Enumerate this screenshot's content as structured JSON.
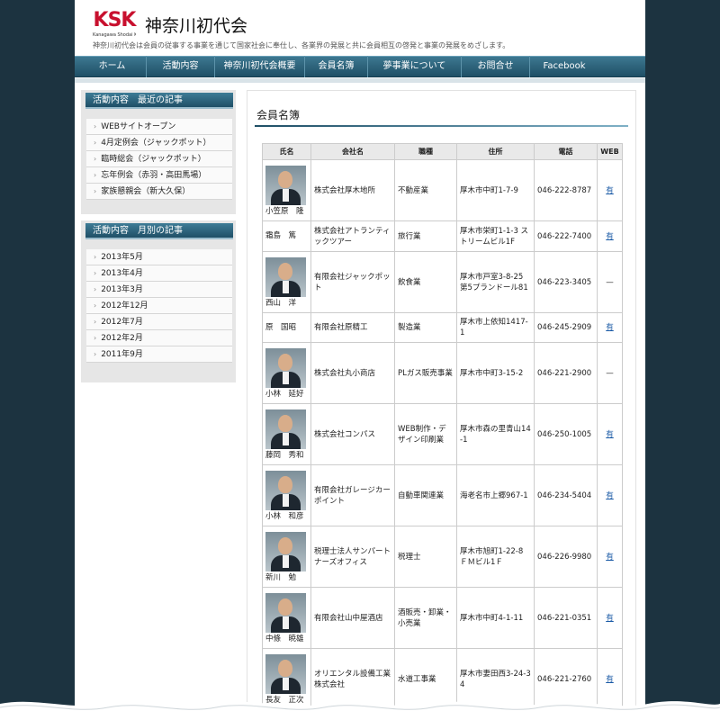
{
  "header": {
    "logo_text": "KSK",
    "logo_sub": "Kanagawa Shodai Kai",
    "site_title": "神奈川初代会",
    "tagline": "神奈川初代会は会員の従事する事業を通じて国家社会に奉仕し、各業界の発展と共に会員相互の啓発と事業の発展をめざします。"
  },
  "nav": [
    {
      "label": "ホーム",
      "w": 76
    },
    {
      "label": "活動内容",
      "w": 76
    },
    {
      "label": "神奈川初代会概要",
      "w": 100
    },
    {
      "label": "会員名簿",
      "w": 70
    },
    {
      "label": "夢事業について",
      "w": 104
    },
    {
      "label": "お問合せ",
      "w": 76
    },
    {
      "label": "Facebook",
      "w": 76
    }
  ],
  "sidebar": {
    "recent_title": "活動内容　最近の記事",
    "recent": [
      "WEBサイトオープン",
      "4月定例会（ジャックポット）",
      "臨時総会（ジャックポット）",
      "忘年例会（赤羽・高田馬場）",
      "家族懇親会（新大久保）"
    ],
    "monthly_title": "活動内容　月別の記事",
    "monthly": [
      "2013年5月",
      "2013年4月",
      "2013年3月",
      "2012年12月",
      "2012年7月",
      "2012年2月",
      "2011年9月"
    ]
  },
  "main": {
    "title": "会員名簿",
    "columns": [
      "氏名",
      "会社名",
      "職種",
      "住所",
      "電話",
      "WEB"
    ],
    "rows": [
      {
        "name": "小笠原　隆",
        "photo": true,
        "company": "株式会社厚木地所",
        "job": "不動産業",
        "address": "厚木市中町1-7-9",
        "phone": "046-222-8787",
        "web": "有",
        "h": 68
      },
      {
        "name": "霜島　篤",
        "photo": false,
        "company": "株式会社アトランティックツアー",
        "job": "旅行業",
        "address": "厚木市栄町1-1-3 ストリームビル1F",
        "phone": "046-222-7400",
        "web": "有",
        "h": 34
      },
      {
        "name": "西山　洋",
        "photo": true,
        "company": "有限会社ジャックポット",
        "job": "飲食業",
        "address": "厚木市戸室3-8-25 第5プランドール81",
        "phone": "046-223-3405",
        "web": "—",
        "h": 68
      },
      {
        "name": "原　国昭",
        "photo": false,
        "company": "有限会社原精工",
        "job": "製造業",
        "address": "厚木市上依知1417-1",
        "phone": "046-245-2909",
        "web": "有",
        "h": 33
      },
      {
        "name": "小林　延好",
        "photo": true,
        "company": "株式会社丸小商店",
        "job": "PLガス販売事業",
        "address": "厚木市中町3-15-2",
        "phone": "046-221-2900",
        "web": "—",
        "h": 68
      },
      {
        "name": "藤岡　秀和",
        "photo": true,
        "company": "株式会社コンパス",
        "job": "WEB制作・デザイン印刷業",
        "address": "厚木市森の里青山14-1",
        "phone": "046-250-1005",
        "web": "有",
        "h": 68
      },
      {
        "name": "小林　和彦",
        "photo": true,
        "company": "有限会社ガレージカーポイント",
        "job": "自動車関連業",
        "address": "海老名市上郷967-1",
        "phone": "046-234-5404",
        "web": "有",
        "h": 68
      },
      {
        "name": "新川　勉",
        "photo": true,
        "company": "税理士法人サンパートナーズオフィス",
        "job": "税理士",
        "address": "厚木市旭町1-22-8 ＦＭビル1Ｆ",
        "phone": "046-226-9980",
        "web": "有",
        "h": 68
      },
      {
        "name": "中條　暁雄",
        "photo": true,
        "company": "有限会社山中屋酒店",
        "job": "酒販売・卸業・小売業",
        "address": "厚木市中町4-1-11",
        "phone": "046-221-0351",
        "web": "有",
        "h": 68
      },
      {
        "name": "長友　正次",
        "photo": true,
        "company": "オリエンタル設備工業株式会社",
        "job": "水道工事業",
        "address": "厚木市妻田西3-24-34",
        "phone": "046-221-2760",
        "web": "有",
        "h": 68
      }
    ]
  }
}
